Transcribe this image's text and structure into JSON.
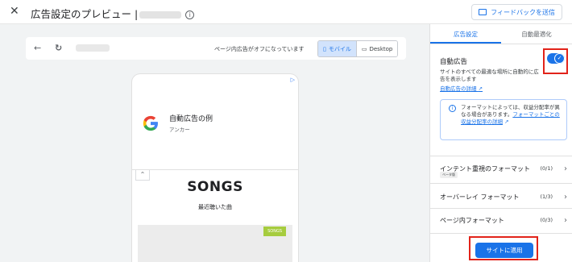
{
  "header": {
    "close_icon": "close-icon",
    "title": "広告設定のプレビュー |",
    "info_icon": "info-icon",
    "feedback_label": "フィードバックを送信"
  },
  "browser": {
    "page_ads_status": "ページ内広告がオフになっています",
    "device_mobile": "モバイル",
    "device_desktop": "Desktop"
  },
  "preview": {
    "ad_choices": "▷",
    "ad_title": "自動広告の例",
    "ad_subtitle": "アンカー",
    "collapse_icon": "⌃",
    "songs_heading": "SONGS",
    "recent_label": "最近聴いた曲",
    "songs_badge": "SONGS"
  },
  "panel": {
    "tabs": [
      {
        "label": "広告設定"
      },
      {
        "label": "自動最適化"
      }
    ],
    "auto_ads_title": "自動広告",
    "auto_ads_enabled": true,
    "auto_ads_description": "サイトのすべての最適な場所に自動的に広告を表示します",
    "auto_ads_link": "自動広告の詳細",
    "notice_text": "フォーマットによっては、収益分配率が異なる場合があります。",
    "notice_link": "フォーマットごとの収益分配率の詳細",
    "formats": [
      {
        "label": "インテント重視のフォーマット",
        "badge": "ベータ版",
        "count": "(0/1)"
      },
      {
        "label": "オーバーレイ フォーマット",
        "count": "(1/3)"
      },
      {
        "label": "ページ内フォーマット",
        "count": "(0/3)"
      }
    ],
    "apply_button": "サイトに適用"
  },
  "colors": {
    "accent": "#1a73e8",
    "highlight_box": "#e2231a",
    "songs_badge": "#a6cc3e"
  }
}
